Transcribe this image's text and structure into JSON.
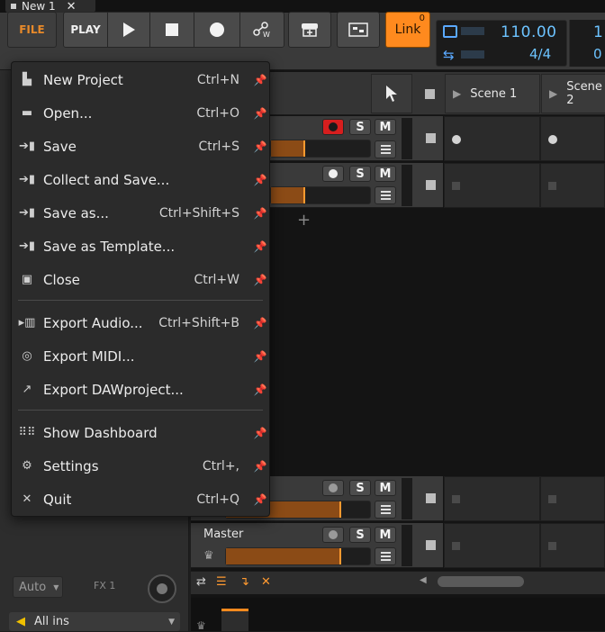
{
  "window": {
    "tab_title": "New 1",
    "tab_close": "✕"
  },
  "toolbar": {
    "file_label": "FILE",
    "play_label": "PLAY",
    "play_icon": "play-icon",
    "stop_icon": "stop-icon",
    "record_icon": "record-icon",
    "automation_icon": "automation-write-icon",
    "link_label": "Link",
    "link_count": "0",
    "tempo": "110.00",
    "time_signature": "4/4",
    "position_1": "1",
    "position_2": "0",
    "accent_color": "#ff8a1e",
    "display_color": "#6cc3ff"
  },
  "file_menu": {
    "items": [
      {
        "label": "New Project",
        "shortcut": "Ctrl+N",
        "icon": "new-document-icon"
      },
      {
        "label": "Open...",
        "shortcut": "Ctrl+O",
        "icon": "folder-icon"
      },
      {
        "label": "Save",
        "shortcut": "Ctrl+S",
        "icon": "save-icon"
      },
      {
        "label": "Collect and Save...",
        "shortcut": "",
        "icon": "collect-save-icon"
      },
      {
        "label": "Save as...",
        "shortcut": "Ctrl+Shift+S",
        "icon": "save-as-icon"
      },
      {
        "label": "Save as Template...",
        "shortcut": "",
        "icon": "save-template-icon"
      },
      {
        "label": "Close",
        "shortcut": "Ctrl+W",
        "icon": "close-document-icon"
      },
      {
        "label": "Export Audio...",
        "shortcut": "Ctrl+Shift+B",
        "icon": "waveform-icon"
      },
      {
        "label": "Export MIDI...",
        "shortcut": "",
        "icon": "midi-icon"
      },
      {
        "label": "Export DAWproject...",
        "shortcut": "",
        "icon": "export-arrow-icon"
      },
      {
        "label": "Show Dashboard",
        "shortcut": "",
        "icon": "dashboard-icon"
      },
      {
        "label": "Settings",
        "shortcut": "Ctrl+,",
        "icon": "gear-icon"
      },
      {
        "label": "Quit",
        "shortcut": "Ctrl+Q",
        "icon": "close-icon"
      }
    ]
  },
  "scenes": [
    "Scene 1",
    "Scene 2"
  ],
  "tracks": {
    "solo_label": "S",
    "mute_label": "M",
    "master_name": "Master",
    "add_symbol": "+"
  },
  "left_panel": {
    "automation_mode": "Auto",
    "fx_label": "FX 1",
    "input_select": "All ins"
  }
}
